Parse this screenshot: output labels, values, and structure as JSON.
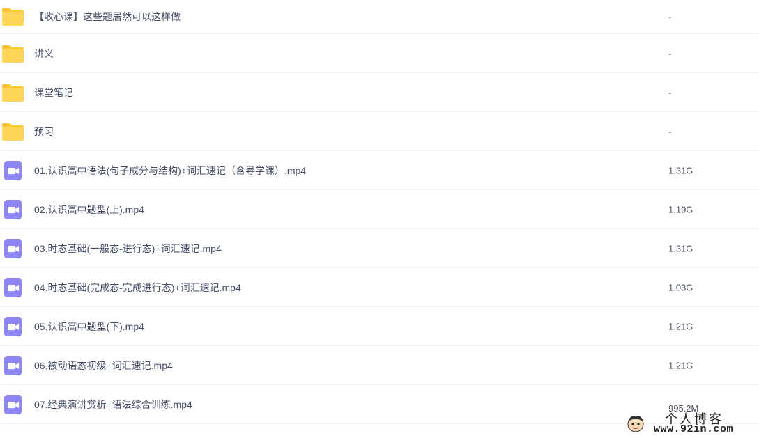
{
  "files": [
    {
      "type": "folder",
      "icon": "folder-icon",
      "name": "【收心课】这些题居然可以这样做",
      "size": "-"
    },
    {
      "type": "folder",
      "icon": "folder-icon",
      "name": "讲义",
      "size": "-"
    },
    {
      "type": "folder",
      "icon": "folder-icon",
      "name": "课堂笔记",
      "size": "-"
    },
    {
      "type": "folder",
      "icon": "folder-icon",
      "name": "预习",
      "size": "-"
    },
    {
      "type": "video",
      "icon": "video-file-icon",
      "name": "01.认识高中语法(句子成分与结构)+词汇速记（含导学课）.mp4",
      "size": "1.31G"
    },
    {
      "type": "video",
      "icon": "video-file-icon",
      "name": "02.认识高中题型(上).mp4",
      "size": "1.19G"
    },
    {
      "type": "video",
      "icon": "video-file-icon",
      "name": "03.时态基础(一般态-进行态)+词汇速记.mp4",
      "size": "1.31G"
    },
    {
      "type": "video",
      "icon": "video-file-icon",
      "name": "04.时态基础(完成态-完成进行态)+词汇速记.mp4",
      "size": "1.03G"
    },
    {
      "type": "video",
      "icon": "video-file-icon",
      "name": "05.认识高中题型(下).mp4",
      "size": "1.21G"
    },
    {
      "type": "video",
      "icon": "video-file-icon",
      "name": "06.被动语态初级+词汇速记.mp4",
      "size": "1.21G"
    },
    {
      "type": "video",
      "icon": "video-file-icon",
      "name": "07.经典演讲赏析+语法综合训练.mp4",
      "size": "995.2M"
    }
  ],
  "watermark": {
    "title": "个人博客",
    "url": "www.92in.com"
  },
  "colors": {
    "folder": "#ffd659",
    "folder_tab": "#ffc530",
    "video": "#8f86f5",
    "name_text": "#424e67",
    "size_text": "#454d5a"
  }
}
